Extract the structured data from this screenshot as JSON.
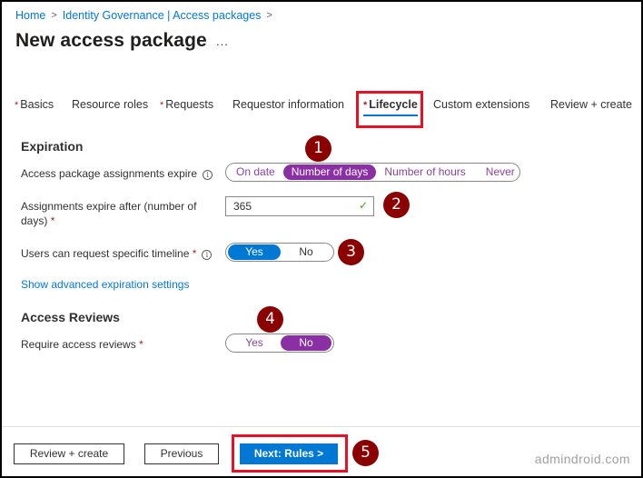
{
  "breadcrumb": [
    "Home",
    "Identity Governance | Access packages"
  ],
  "breadcrumb_separator": ">",
  "page_title": "New access package",
  "more_label": "...",
  "tabs": [
    {
      "label": "Basics",
      "required": true,
      "active": false
    },
    {
      "label": "Resource roles",
      "required": false,
      "active": false
    },
    {
      "label": "Requests",
      "required": true,
      "active": false
    },
    {
      "label": "Requestor information",
      "required": false,
      "active": false
    },
    {
      "label": "Lifecycle",
      "required": true,
      "active": true
    },
    {
      "label": "Custom extensions",
      "required": false,
      "active": false
    },
    {
      "label": "Review + create",
      "required": false,
      "active": false
    }
  ],
  "required_mark": "*",
  "expiration": {
    "title": "Expiration",
    "assignments_expire_label": "Access package assignments expire",
    "assignments_expire_options": [
      "On date",
      "Number of days",
      "Number of hours",
      "Never"
    ],
    "assignments_expire_selected": "Number of days",
    "expire_after_label": "Assignments expire after (number of days)",
    "expire_after_value": "365",
    "specific_timeline_label": "Users can request specific timeline",
    "specific_timeline_options": [
      "Yes",
      "No"
    ],
    "specific_timeline_selected": "Yes",
    "advanced_link": "Show advanced expiration settings"
  },
  "access_reviews": {
    "title": "Access Reviews",
    "require_label": "Require access reviews",
    "options": [
      "Yes",
      "No"
    ],
    "selected": "No"
  },
  "info_glyph": "i",
  "check_glyph": "✓",
  "annotations": [
    "1",
    "2",
    "3",
    "4",
    "5"
  ],
  "footer": {
    "review_create": "Review + create",
    "previous": "Previous",
    "next": "Next: Rules >"
  },
  "watermark": "admindroid.com",
  "colors": {
    "accent_blue": "#0078d4",
    "selected_purple": "#8b2fa4",
    "annotation_red": "#8b0000",
    "highlight_red": "#e81123"
  }
}
